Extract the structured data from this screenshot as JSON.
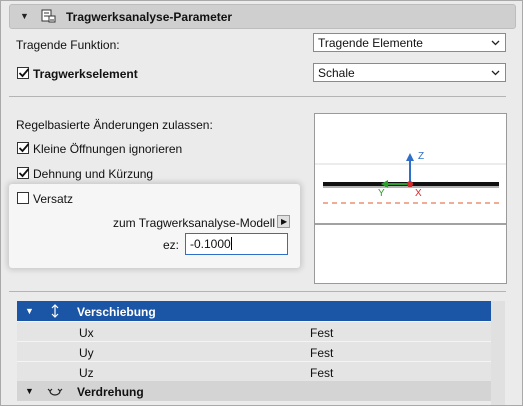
{
  "header": {
    "title": "Tragwerksanalyse-Parameter"
  },
  "tragende_funktion": {
    "label": "Tragende Funktion:",
    "value": "Tragende Elemente"
  },
  "tragwerkselement": {
    "label": "Tragwerkselement",
    "checked": true,
    "value": "Schale"
  },
  "regel": {
    "label": "Regelbasierte Änderungen zulassen:",
    "kleine_oeffnungen": "Kleine Öffnungen ignorieren",
    "dehnung": "Dehnung und Kürzung",
    "versatz": "Versatz"
  },
  "offset": {
    "model_label": "zum Tragwerksanalyse-Modell",
    "ez_label": "ez:",
    "ez_value": "-0.1000"
  },
  "preview": {
    "z_label": "Z",
    "y_label": "Y",
    "x_label": "X"
  },
  "table": {
    "group1": {
      "name": "Verschiebung"
    },
    "rows": [
      {
        "name": "Ux",
        "value": "Fest"
      },
      {
        "name": "Uy",
        "value": "Fest"
      },
      {
        "name": "Uz",
        "value": "Fest"
      }
    ],
    "group2": {
      "name": "Verdrehung"
    }
  },
  "colors": {
    "selection": "#1b55a5",
    "accent_blue": "#2f6fc9",
    "axis_green": "#2aa12a",
    "axis_red": "#d62a2a"
  }
}
